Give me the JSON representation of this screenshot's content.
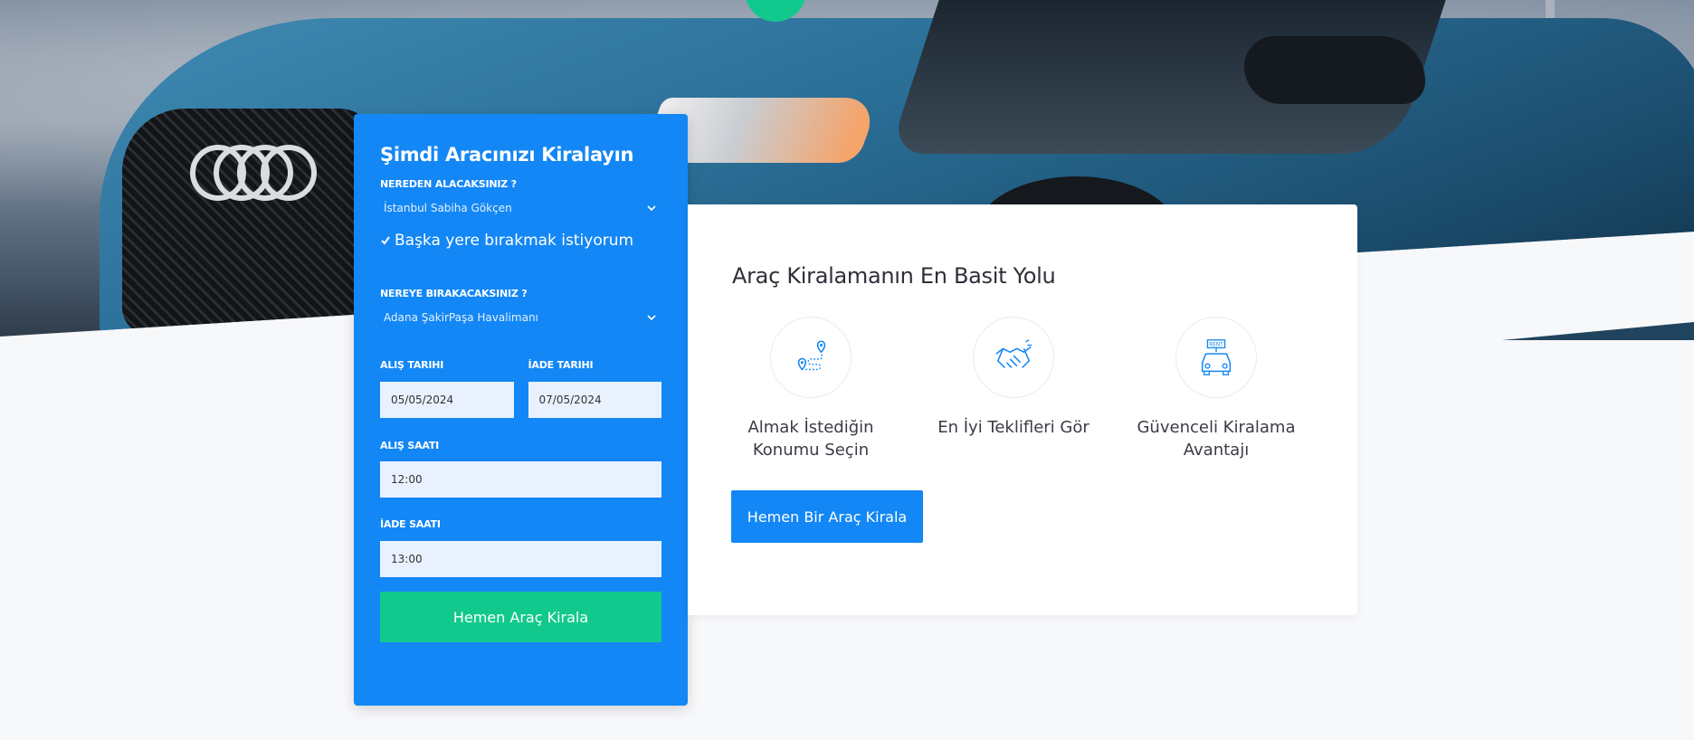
{
  "colors": {
    "primary": "#1387f5",
    "success": "#12c98d",
    "input_bg": "#e9f1ff"
  },
  "form": {
    "title": "Şimdi Aracınızı Kiralayın",
    "pickup_location_label": "NEREDEN ALACAKSINIZ ?",
    "pickup_location_value": "İstanbul Sabiha Gökçen",
    "different_dropoff_label": "Başka yere bırakmak istiyorum",
    "different_dropoff_checked": true,
    "dropoff_location_label": "NEREYE BIRAKACAKSINIZ ?",
    "dropoff_location_value": "Adana ŞakirPaşa Havalimanı",
    "pickup_date_label": "ALIŞ TARIHI",
    "pickup_date_value": "05/05/2024",
    "return_date_label": "İADE TARIHI",
    "return_date_value": "07/05/2024",
    "pickup_time_label": "ALIŞ SAATI",
    "pickup_time_value": "12:00",
    "return_time_label": "İADE SAATI",
    "return_time_value": "13:00",
    "submit_label": "Hemen Araç Kirala"
  },
  "info": {
    "title": "Araç Kiralamanın En Basit Yolu",
    "features": [
      {
        "icon": "location-route-icon",
        "line1": "Almak İstediğin",
        "line2": "Konumu Seçin"
      },
      {
        "icon": "handshake-icon",
        "line1": "En İyi Teklifleri Gör",
        "line2": ""
      },
      {
        "icon": "rent-car-icon",
        "line1": "Güvenceli Kiralama",
        "line2": "Avantajı"
      }
    ],
    "cta_label": "Hemen Bir Araç Kirala"
  }
}
